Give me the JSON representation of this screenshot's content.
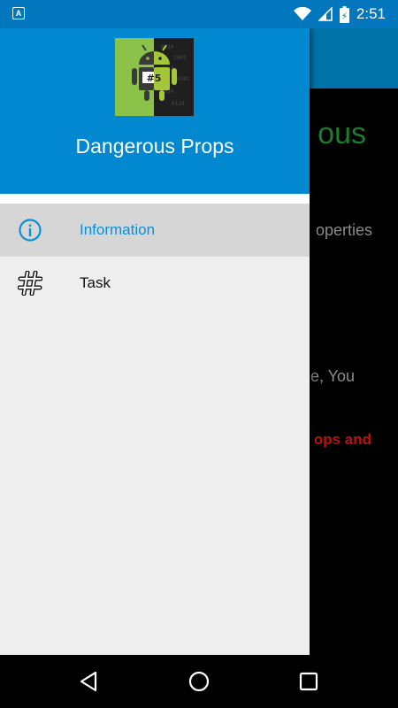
{
  "status_bar": {
    "notification_letter": "A",
    "battery_indicator": "⚡",
    "time": "2:51"
  },
  "background_screen": {
    "title_fragment": "ous",
    "line1_fragment": "operties",
    "line2_fragment": "e, You",
    "line3_fragment": "ops and"
  },
  "drawer": {
    "app_name": "Dangerous Props",
    "logo_badge": "#5",
    "menu": [
      {
        "label": "Information",
        "icon": "info-circle-icon",
        "selected": true
      },
      {
        "label": "Task",
        "icon": "hash-icon",
        "selected": false
      }
    ]
  },
  "nav_bar": {
    "buttons": [
      "back-icon",
      "home-icon",
      "recents-icon"
    ]
  },
  "colors": {
    "header_blue": "#0288d1",
    "status_blue": "#0277bd",
    "accent": "#0b8fd6",
    "drawer_bg": "#eeeeee",
    "selected_bg": "#d6d6d6",
    "warning_red": "#b3160f",
    "title_green": "#1b7d2d"
  }
}
